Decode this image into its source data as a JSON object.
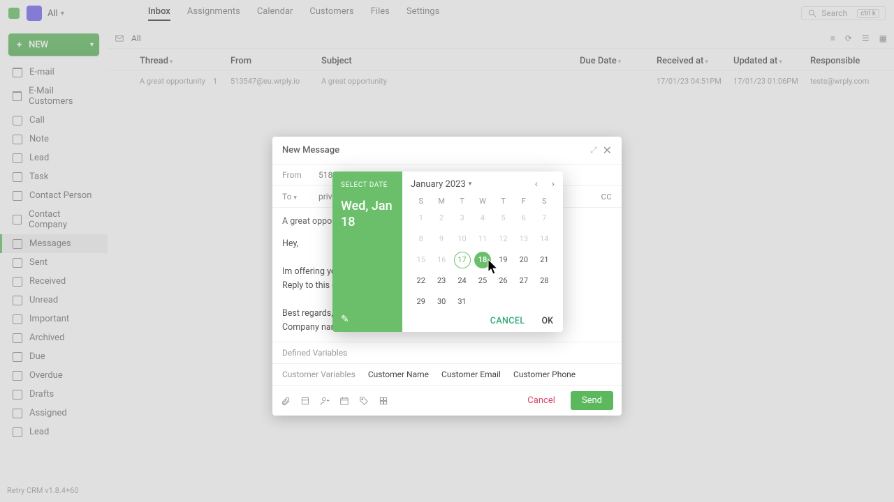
{
  "topbar": {
    "workspace_label": "All",
    "tabs": [
      "Inbox",
      "Assignments",
      "Calendar",
      "Customers",
      "Files",
      "Settings"
    ],
    "active_tab_index": 0,
    "search_placeholder": "Search",
    "kbd_hint": "ctrl k"
  },
  "sidebar": {
    "new_label": "NEW",
    "items": [
      {
        "label": "E-mail",
        "icon": "mail"
      },
      {
        "label": "E-Mail Customers",
        "icon": "mail"
      },
      {
        "label": "Call",
        "icon": "phone"
      },
      {
        "label": "Note",
        "icon": "note"
      },
      {
        "label": "Lead",
        "icon": "lead"
      },
      {
        "label": "Task",
        "icon": "task"
      },
      {
        "label": "Contact Person",
        "icon": "person"
      },
      {
        "label": "Contact Company",
        "icon": "company"
      },
      {
        "label": "Messages",
        "icon": "messages",
        "active": true
      },
      {
        "label": "Sent",
        "icon": "sent"
      },
      {
        "label": "Received",
        "icon": "received"
      },
      {
        "label": "Unread",
        "icon": "unread"
      },
      {
        "label": "Important",
        "icon": "important"
      },
      {
        "label": "Archived",
        "icon": "archived"
      },
      {
        "label": "Due",
        "icon": "due"
      },
      {
        "label": "Overdue",
        "icon": "overdue"
      },
      {
        "label": "Drafts",
        "icon": "drafts"
      },
      {
        "label": "Assigned",
        "icon": "assigned"
      },
      {
        "label": "Lead",
        "icon": "lead"
      }
    ]
  },
  "list": {
    "filter_label": "All",
    "columns": {
      "thread": "Thread",
      "from": "From",
      "subject": "Subject",
      "due": "Due Date",
      "received": "Received at",
      "updated": "Updated at",
      "responsible": "Responsible"
    },
    "rows": [
      {
        "thread": "A great opportunity",
        "thread_count": "1",
        "from": "513547@eu.wrply.io",
        "subject": "A great opportunity",
        "due": "",
        "received": "17/01/23 04:51PM",
        "updated": "17/01/23 01:06PM",
        "responsible": "tests@wrply.com"
      }
    ]
  },
  "compose": {
    "title": "New Message",
    "from_label": "From",
    "from_value": "518547@eu.wrply.io",
    "to_label": "To",
    "to_value": "priv",
    "cc_label": "CC",
    "subject": "A great opportunity",
    "body_lines": [
      "Hey,",
      "",
      "Im offering you a",
      "Reply to this email",
      "",
      "Best regards,",
      "Company name"
    ],
    "defined_vars_label": "Defined Variables",
    "customer_vars_label": "Customer Variables",
    "customer_vars": [
      "Customer Name",
      "Customer Email",
      "Customer Phone"
    ],
    "cancel_label": "Cancel",
    "send_label": "Send"
  },
  "datepicker": {
    "select_label": "SELECT DATE",
    "selected_readout_line1": "Wed, Jan",
    "selected_readout_line2": "18",
    "month_year": "January 2023",
    "dow": [
      "S",
      "M",
      "T",
      "W",
      "T",
      "F",
      "S"
    ],
    "weeks": [
      [
        {
          "n": "1",
          "out": true
        },
        {
          "n": "2",
          "out": true
        },
        {
          "n": "3",
          "out": true
        },
        {
          "n": "4",
          "out": true
        },
        {
          "n": "5",
          "out": true
        },
        {
          "n": "6",
          "out": true
        },
        {
          "n": "7",
          "out": true
        }
      ],
      [
        {
          "n": "8",
          "out": true
        },
        {
          "n": "9",
          "out": true
        },
        {
          "n": "10",
          "out": true
        },
        {
          "n": "11",
          "out": true
        },
        {
          "n": "12",
          "out": true
        },
        {
          "n": "13",
          "out": true
        },
        {
          "n": "14",
          "out": true
        }
      ],
      [
        {
          "n": "15",
          "out": true
        },
        {
          "n": "16",
          "out": true
        },
        {
          "n": "17",
          "today": true
        },
        {
          "n": "18",
          "selected": true
        },
        {
          "n": "19"
        },
        {
          "n": "20"
        },
        {
          "n": "21"
        }
      ],
      [
        {
          "n": "22"
        },
        {
          "n": "23"
        },
        {
          "n": "24"
        },
        {
          "n": "25"
        },
        {
          "n": "26"
        },
        {
          "n": "27"
        },
        {
          "n": "28"
        }
      ],
      [
        {
          "n": "29"
        },
        {
          "n": "30"
        },
        {
          "n": "31"
        },
        {
          "n": ""
        },
        {
          "n": ""
        },
        {
          "n": ""
        },
        {
          "n": ""
        }
      ]
    ],
    "cancel_label": "CANCEL",
    "ok_label": "OK"
  },
  "footer": {
    "version": "Retry CRM v1.8.4+60"
  },
  "colors": {
    "accent": "#5cb85c"
  }
}
